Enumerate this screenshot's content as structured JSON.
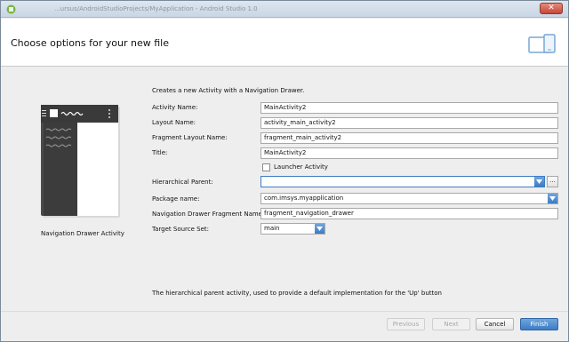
{
  "titlebar": {
    "title": "...ursus/AndroidStudioProjects/MyApplication - Android Studio 1.0",
    "close_glyph": "✕"
  },
  "header": {
    "title": "Choose options for your new file"
  },
  "preview": {
    "caption": "Navigation Drawer Activity"
  },
  "description": "Creates a new Activity with a Navigation Drawer.",
  "form": {
    "activity_name": {
      "label": "Activity Name:",
      "value": "MainActivity2"
    },
    "layout_name": {
      "label": "Layout Name:",
      "value": "activity_main_activity2"
    },
    "fragment_layout_name": {
      "label": "Fragment Layout Name:",
      "value": "fragment_main_activity2"
    },
    "title": {
      "label": "Title:",
      "value": "MainActivity2"
    },
    "launcher_activity": {
      "label": "Launcher Activity",
      "checked": false
    },
    "hierarchical_parent": {
      "label": "Hierarchical Parent:",
      "value": "",
      "browse_label": "..."
    },
    "package_name": {
      "label": "Package name:",
      "value": "com.imsys.myapplication"
    },
    "nav_drawer_fragment_name": {
      "label": "Navigation Drawer Fragment Name:",
      "value": "fragment_navigation_drawer"
    },
    "target_source_set": {
      "label": "Target Source Set:",
      "value": "main"
    }
  },
  "footer": {
    "help_text": "The hierarchical parent activity, used to provide a default implementation for the 'Up' button"
  },
  "buttons": {
    "previous": "Previous",
    "next": "Next",
    "cancel": "Cancel",
    "finish": "Finish"
  },
  "colors": {
    "accent": "#3d7cc4",
    "header_bg": "#ffffff",
    "dialog_bg": "#eeeeee"
  }
}
